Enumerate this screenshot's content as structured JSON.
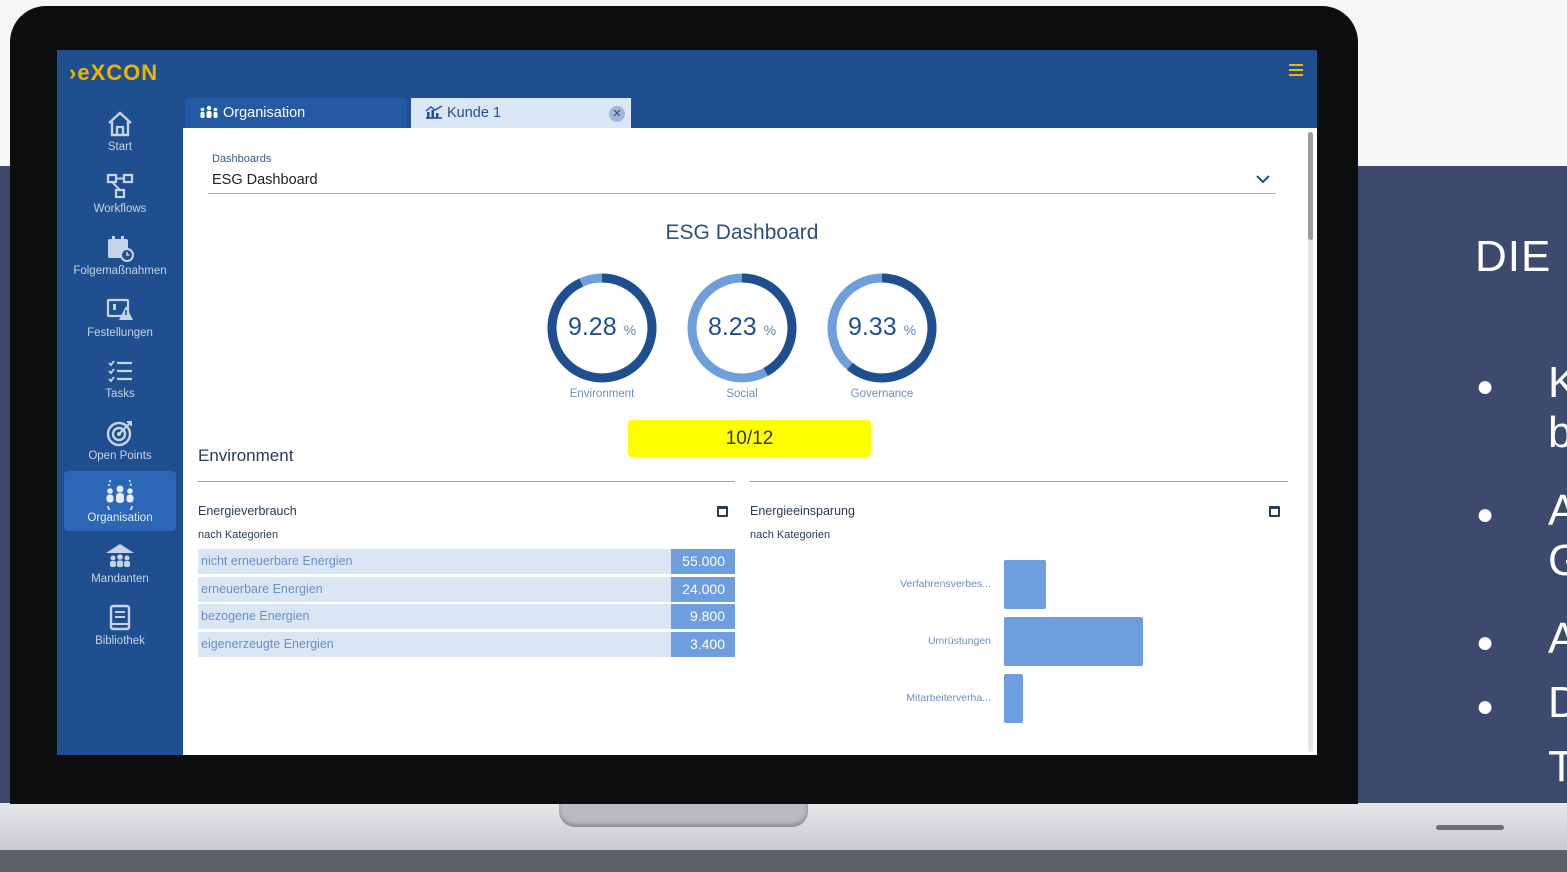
{
  "slide": {
    "title": "DIE F",
    "bullets": [
      "K",
      "b",
      "A",
      "G",
      "A",
      "D",
      "T"
    ]
  },
  "app": {
    "logo_prefix": "e",
    "logo_suffix": "XCON",
    "accent_color": "#f0b400",
    "primary_color": "#1f4f8f"
  },
  "sidebar": {
    "items": [
      "Start",
      "Workflows",
      "Folgemaßnahmen",
      "Festellungen",
      "Tasks",
      "Open Points",
      "Organisation",
      "Mandanten",
      "Bibliothek"
    ],
    "active": "Organisation"
  },
  "tabs": [
    {
      "label": "Organisation",
      "icon": "organisation-people-icon"
    },
    {
      "label": "Kunde 1",
      "icon": "chart-building-icon",
      "active": true
    }
  ],
  "dashboard_select": {
    "label": "Dashboards",
    "value": "ESG Dashboard"
  },
  "dashboard": {
    "title": "ESG Dashboard"
  },
  "gauges": [
    {
      "value": "9.28",
      "unit": "%",
      "label": "Environment",
      "fill": 0.93
    },
    {
      "value": "8.23",
      "unit": "%",
      "label": "Social",
      "fill": 0.42
    },
    {
      "value": "9.33",
      "unit": "%",
      "label": "Governance",
      "fill": 0.61
    }
  ],
  "counter": "10/12",
  "section": {
    "title": "Environment"
  },
  "cards": [
    {
      "title": "Energieverbrauch",
      "subtitle": "nach Kategorien",
      "rows": [
        {
          "label": "nicht erneuerbare Energien",
          "value": "55.000"
        },
        {
          "label": "erneuerbare Energien",
          "value": "24.000"
        },
        {
          "label": "bezogene Energien",
          "value": "9.800"
        },
        {
          "label": "eigenerzeugte Energien",
          "value": "3.400"
        }
      ]
    },
    {
      "title": "Energieeinsparung",
      "subtitle": "nach Kategorien"
    }
  ],
  "chart_data": {
    "type": "bar",
    "orientation": "horizontal",
    "categories": [
      "Verfahrensverbes...",
      "Umrüstungen",
      "Mitarbeiterverha..."
    ],
    "values": [
      30,
      100,
      14
    ],
    "title": "Energieeinsparung",
    "subtitle": "nach Kategorien",
    "xlabel": "",
    "ylabel": "",
    "grid": false,
    "color": "#6e9edc"
  }
}
